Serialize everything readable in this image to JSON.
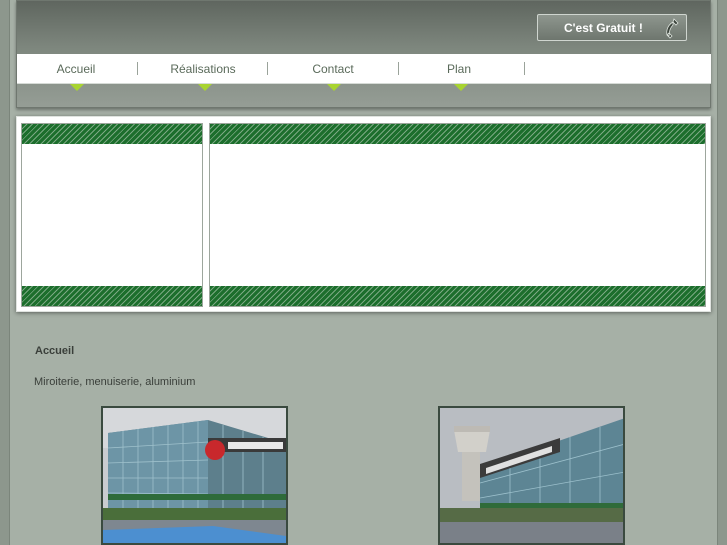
{
  "header": {
    "cta_label": "C'est Gratuit !",
    "cta_icon": "phone-icon"
  },
  "nav": {
    "items": [
      {
        "label": "Accueil"
      },
      {
        "label": "Réalisations"
      },
      {
        "label": "Contact"
      },
      {
        "label": "Plan"
      }
    ],
    "arrow_color": "#a8d430"
  },
  "banner": {
    "stripe_color": "#1c6e2c"
  },
  "content": {
    "title": "Accueil",
    "text": "Miroiterie, menuiserie, aluminium"
  },
  "photos": [
    {
      "name": "store-photo-1"
    },
    {
      "name": "store-photo-2"
    }
  ]
}
